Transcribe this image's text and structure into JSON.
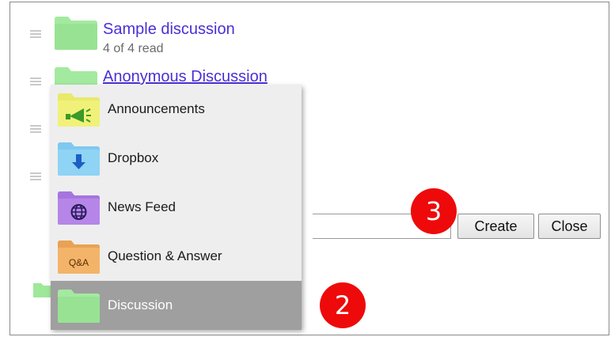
{
  "list": {
    "items": [
      {
        "title": "Sample discussion",
        "subtitle": "4 of 4 read"
      },
      {
        "title": "Anonymous Discussion"
      }
    ]
  },
  "form": {
    "create_label": "Create",
    "close_label": "Close"
  },
  "menu": {
    "items": [
      {
        "label": "Announcements",
        "icon": "announcements-folder-icon",
        "color": "#f1f179"
      },
      {
        "label": "Dropbox",
        "icon": "dropbox-folder-icon",
        "color": "#8fd3f5"
      },
      {
        "label": "News Feed",
        "icon": "news-feed-folder-icon",
        "color": "#b586e8"
      },
      {
        "label": "Question & Answer",
        "icon": "qa-folder-icon",
        "color": "#f3b46a",
        "icon_text": "Q&A"
      },
      {
        "label": "Discussion",
        "icon": "discussion-folder-icon",
        "color": "#9ee89a",
        "selected": true
      }
    ]
  },
  "annotations": {
    "step_2": "2",
    "step_3": "3",
    "color": "#ee0a0a"
  },
  "colors": {
    "link": "#4a2fd6",
    "folder_green": "#9ee89a",
    "menu_bg": "#eeeeee",
    "menu_selected": "#9f9f9f"
  }
}
